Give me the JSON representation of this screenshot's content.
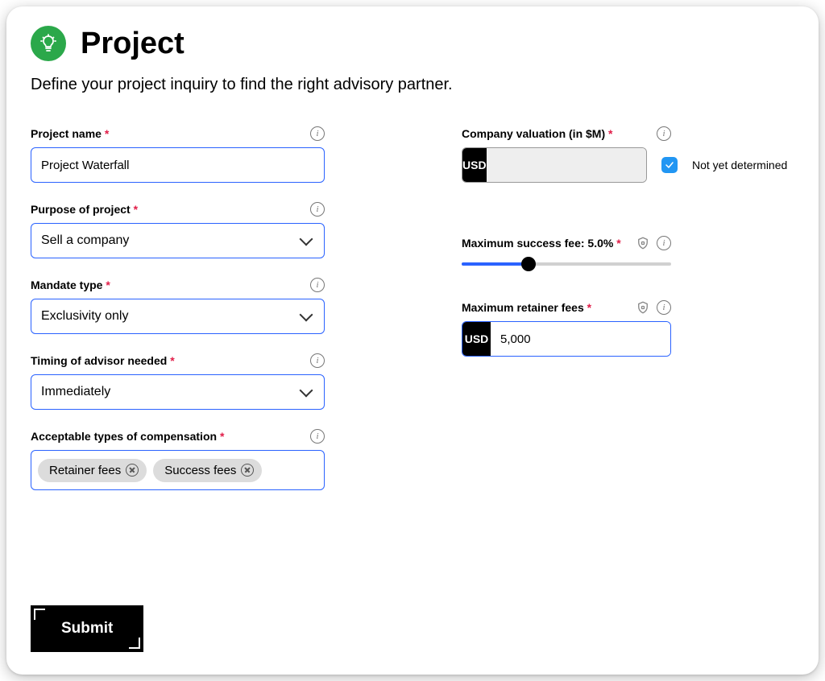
{
  "header": {
    "title": "Project",
    "subtitle": "Define your project inquiry to find the right advisory partner."
  },
  "required_marker": "*",
  "currency": "USD",
  "left": {
    "project_name": {
      "label": "Project name ",
      "value": "Project Waterfall"
    },
    "purpose": {
      "label": "Purpose of project ",
      "value": "Sell a company"
    },
    "mandate_type": {
      "label": "Mandate type ",
      "value": "Exclusivity only"
    },
    "timing": {
      "label": "Timing of advisor needed ",
      "value": "Immediately"
    },
    "compensation": {
      "label": "Acceptable types of compensation ",
      "tags": [
        "Retainer fees",
        "Success fees"
      ]
    }
  },
  "right": {
    "valuation": {
      "label": "Company valuation (in $M) ",
      "checkbox_label": "Not yet determined",
      "not_determined": true
    },
    "success_fee": {
      "label": "Maximum success fee: ",
      "value_display": "5.0% ",
      "value_percent": 5.0
    },
    "retainer": {
      "label": "Maximum retainer fees ",
      "value": "5,000"
    }
  },
  "submit_label": "Submit"
}
